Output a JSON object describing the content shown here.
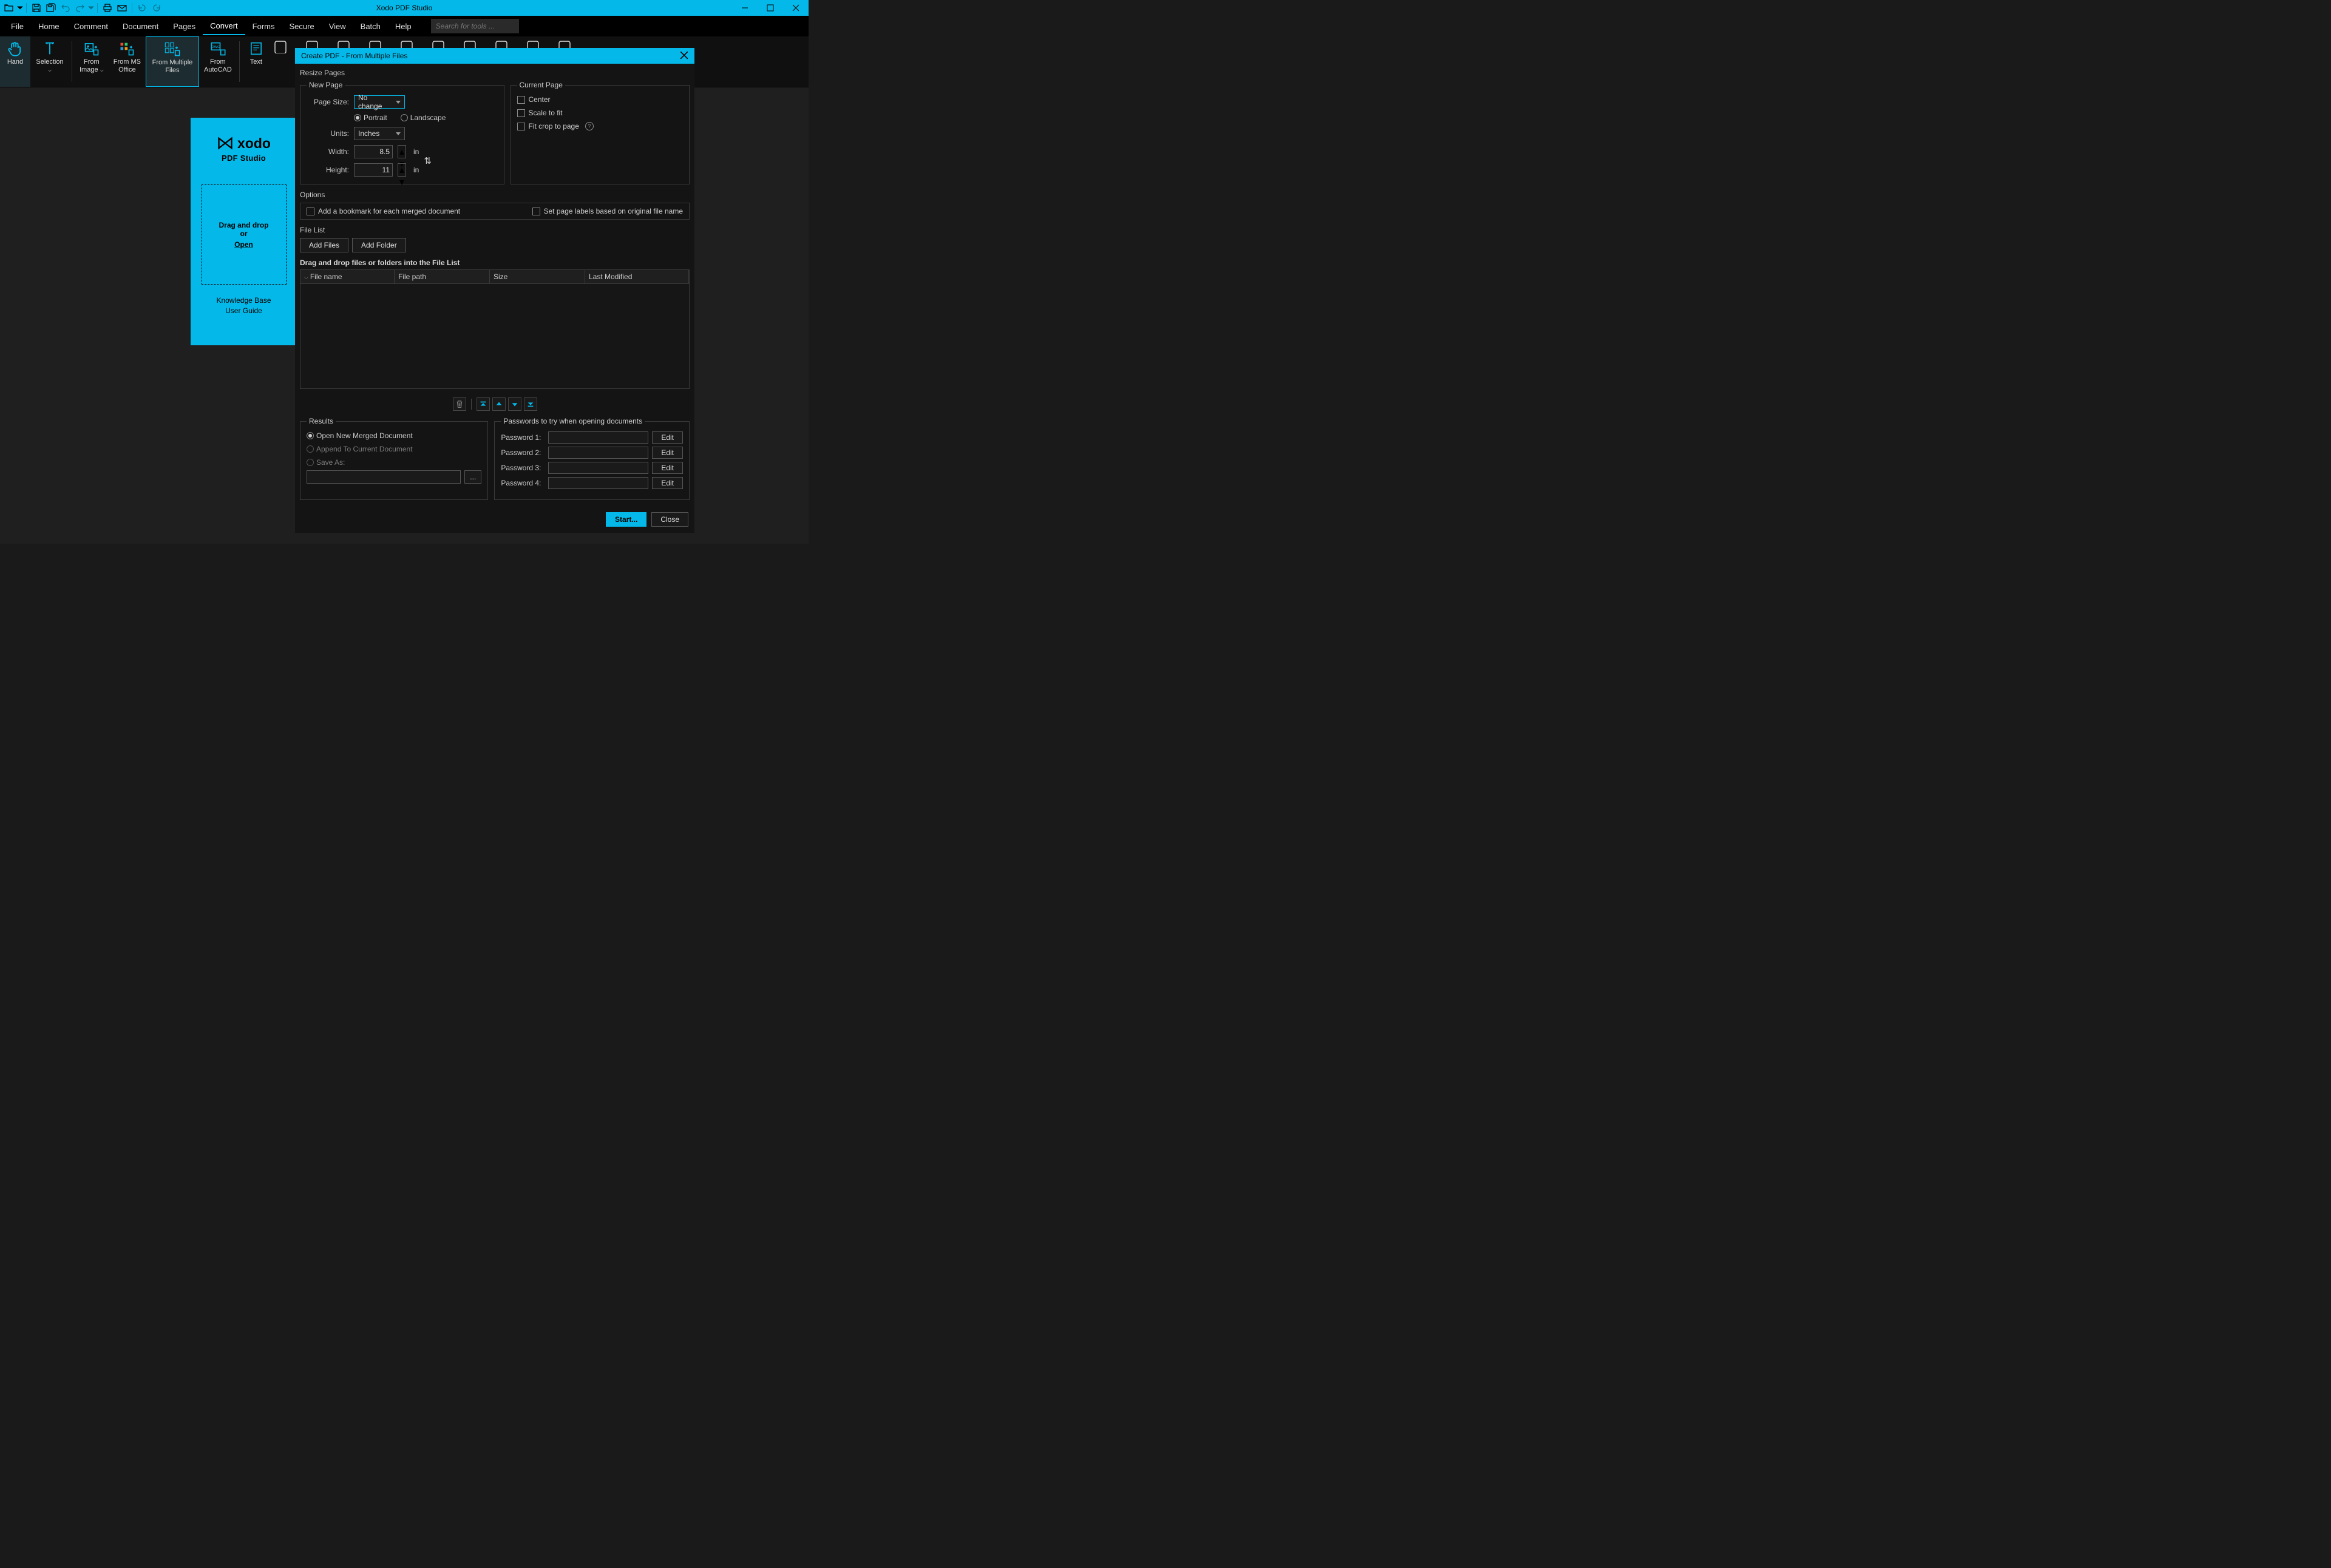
{
  "app_title": "Xodo PDF Studio",
  "menubar": [
    "File",
    "Home",
    "Comment",
    "Document",
    "Pages",
    "Convert",
    "Forms",
    "Secure",
    "View",
    "Batch",
    "Help"
  ],
  "menubar_active": "Convert",
  "search_placeholder": "Search for tools ...",
  "ribbon": [
    {
      "label": "Hand",
      "icon": "hand",
      "selected": true
    },
    {
      "label": "Selection",
      "icon": "text-select",
      "dropdown": true
    },
    {
      "label": "From\nImage",
      "icon": "from-image",
      "dropdown": true
    },
    {
      "label": "From MS\nOffice",
      "icon": "from-office"
    },
    {
      "label": "From Multiple\nFiles",
      "icon": "from-multi",
      "selected": true
    },
    {
      "label": "From\nAutoCAD",
      "icon": "from-dwg"
    },
    {
      "label": "Text",
      "icon": "text"
    }
  ],
  "start_card": {
    "brand": "xodo",
    "sub": "PDF Studio",
    "drop1": "Drag and drop",
    "drop2": "or",
    "drop3": "Open",
    "link1": "Knowledge Base",
    "link2": "User Guide"
  },
  "dialog": {
    "title": "Create PDF - From Multiple Files",
    "resize_label": "Resize Pages",
    "new_page": {
      "legend": "New Page",
      "page_size_label": "Page Size:",
      "page_size_value": "No change",
      "portrait": "Portrait",
      "landscape": "Landscape",
      "units_label": "Units:",
      "units_value": "Inches",
      "width_label": "Width:",
      "width_value": "8.5",
      "height_label": "Height:",
      "height_value": "11",
      "unit_suffix": "in"
    },
    "current_page": {
      "legend": "Current Page",
      "center": "Center",
      "scale": "Scale to fit",
      "fitcrop": "Fit crop to page"
    },
    "options": {
      "legend": "Options",
      "bookmark": "Add a bookmark for each merged document",
      "pagelabels": "Set page labels based on original file name"
    },
    "filelist": {
      "legend": "File List",
      "add_files": "Add Files",
      "add_folder": "Add Folder",
      "hint": "Drag and drop files or folders into the File List",
      "cols": [
        "File name",
        "File path",
        "Size",
        "Last Modified"
      ]
    },
    "results": {
      "legend": "Results",
      "open": "Open New Merged Document",
      "append": "Append To Current Document",
      "saveas": "Save As:",
      "browse": "..."
    },
    "passwords": {
      "legend": "Passwords to try when opening documents",
      "labels": [
        "Password 1:",
        "Password 2:",
        "Password 3:",
        "Password 4:"
      ],
      "edit": "Edit"
    },
    "footer": {
      "start": "Start...",
      "close": "Close"
    }
  }
}
